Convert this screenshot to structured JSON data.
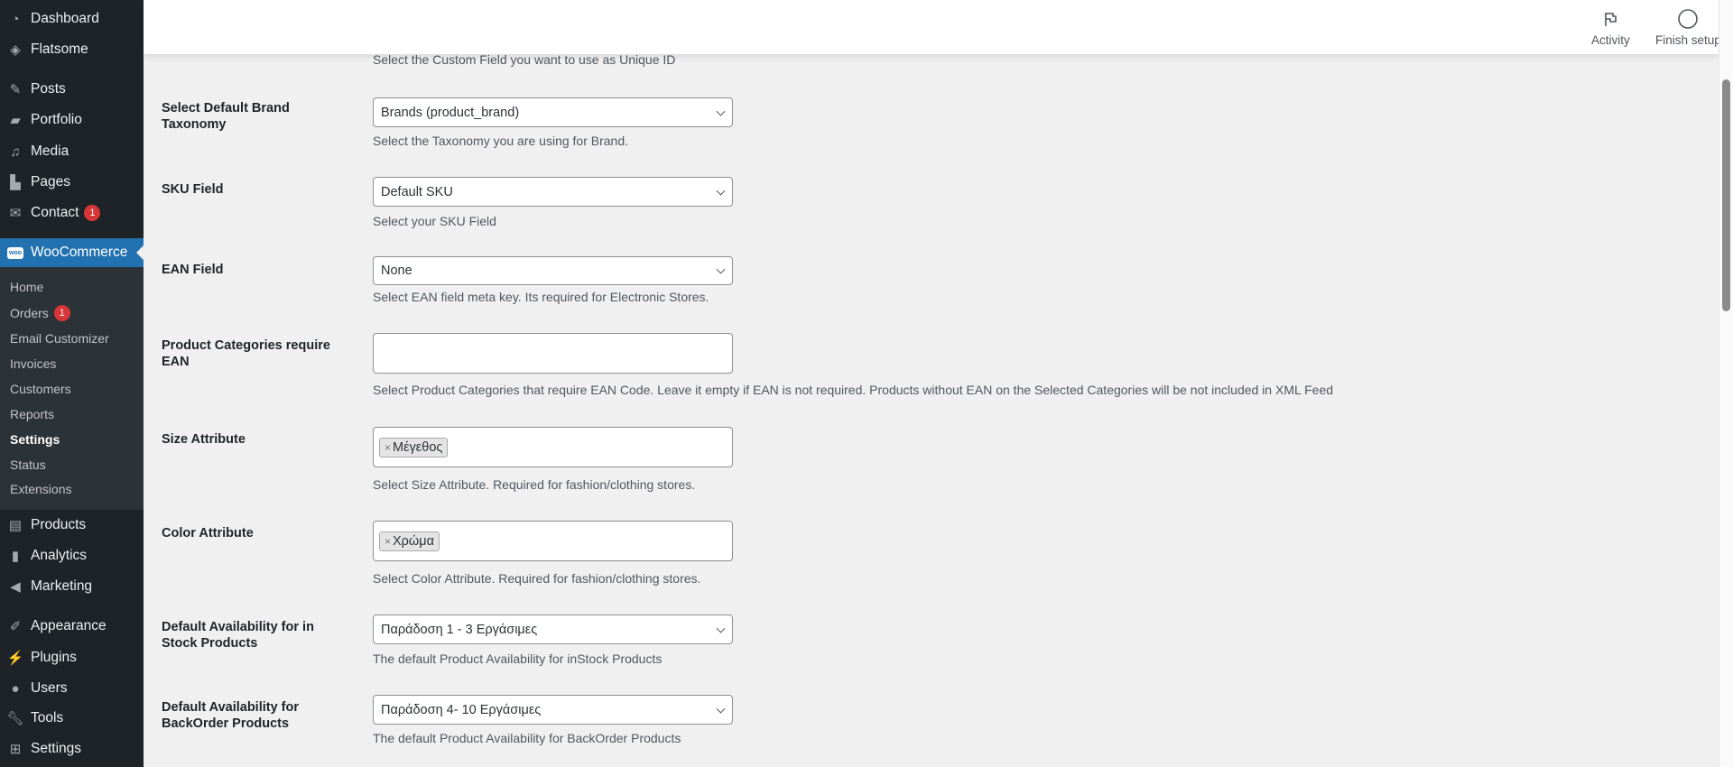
{
  "sidebar": {
    "top": [
      {
        "label": "Dashboard",
        "icon": "dashboard-icon"
      },
      {
        "label": "Flatsome",
        "icon": "flatsome-icon"
      },
      {
        "label": "Posts",
        "icon": "pin-icon"
      },
      {
        "label": "Portfolio",
        "icon": "folder-icon"
      },
      {
        "label": "Media",
        "icon": "media-icon"
      },
      {
        "label": "Pages",
        "icon": "pages-icon"
      },
      {
        "label": "Contact",
        "icon": "mail-icon",
        "badge": "1"
      }
    ],
    "woocommerce": "WooCommerce",
    "sub": [
      {
        "label": "Home"
      },
      {
        "label": "Orders",
        "badge": "1"
      },
      {
        "label": "Email Customizer"
      },
      {
        "label": "Invoices"
      },
      {
        "label": "Customers"
      },
      {
        "label": "Reports"
      },
      {
        "label": "Settings"
      },
      {
        "label": "Status"
      },
      {
        "label": "Extensions"
      }
    ],
    "bottom": [
      {
        "label": "Products"
      },
      {
        "label": "Analytics"
      },
      {
        "label": "Marketing"
      },
      {
        "label": "Appearance"
      },
      {
        "label": "Plugins"
      },
      {
        "label": "Users"
      },
      {
        "label": "Tools"
      },
      {
        "label": "Settings"
      }
    ]
  },
  "header": {
    "activity": "Activity",
    "finish_setup": "Finish setup"
  },
  "form": {
    "top_desc": "Select the Custom Field you want to use as Unique ID",
    "brand": {
      "label": "Select Default Brand Taxonomy",
      "value": "Brands (product_brand)",
      "desc": "Select the Taxonomy you are using for Brand."
    },
    "sku": {
      "label": "SKU Field",
      "value": "Default SKU",
      "desc": "Select your SKU Field"
    },
    "ean": {
      "label": "EAN Field",
      "value": "None",
      "desc": "Select EAN field meta key. Its required for Electronic Stores."
    },
    "cats": {
      "label": "Product Categories require EAN",
      "value": "",
      "desc": "Select Product Categories that require EAN Code. Leave it empty if EAN is not required. Products without EAN on the Selected Categories will be not included in XML Feed"
    },
    "size": {
      "label": "Size Attribute",
      "tag": "Μέγεθος",
      "desc": "Select Size Attribute. Required for fashion/clothing stores."
    },
    "color": {
      "label": "Color Attribute",
      "tag": "Χρώμα",
      "desc": "Select Color Attribute. Required for fashion/clothing stores."
    },
    "instock": {
      "label": "Default Availability for in Stock Products",
      "value": "Παράδοση 1 - 3 Εργάσιμες",
      "desc": "The default Product Availability for inStock Products"
    },
    "backorder": {
      "label": "Default Availability for BackOrder Products",
      "value": "Παράδοση 4- 10 Εργάσιμες",
      "desc": "The default Product Availability for BackOrder Products"
    }
  }
}
